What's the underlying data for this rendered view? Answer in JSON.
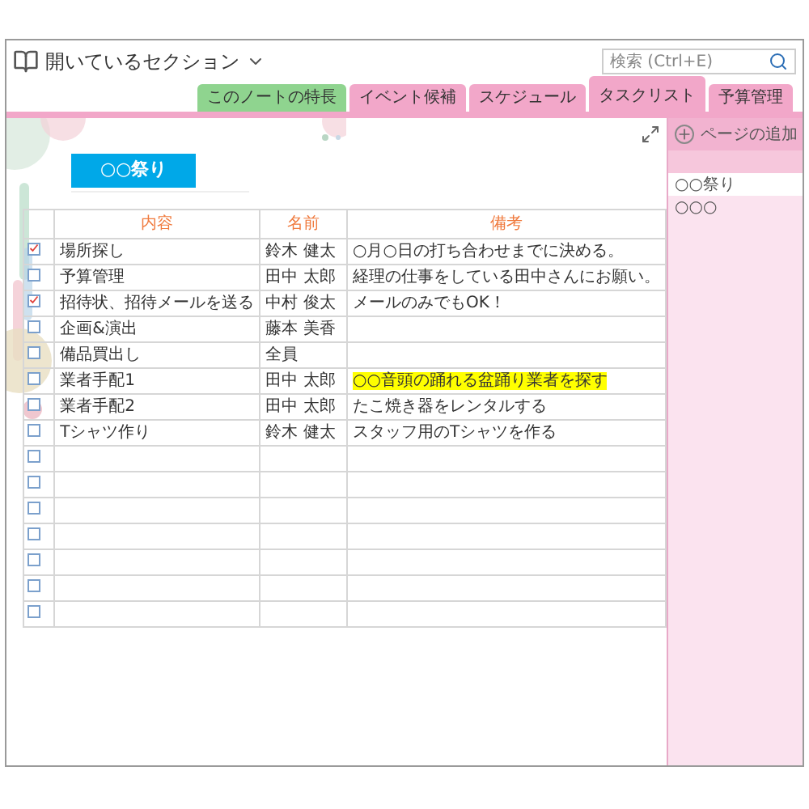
{
  "window": {
    "title": "開いているセクション"
  },
  "search": {
    "placeholder": "検索 (Ctrl+E)"
  },
  "tabs": [
    {
      "label": "このノートの特長",
      "selected": false,
      "color": "#8fd48f"
    },
    {
      "label": "イベント候補",
      "selected": false,
      "color": "#f2a7c9"
    },
    {
      "label": "スケジュール",
      "selected": false,
      "color": "#f2a7c9"
    },
    {
      "label": "タスクリスト",
      "selected": true,
      "color": "#f2a7c9"
    },
    {
      "label": "予算管理",
      "selected": false,
      "color": "#f2a7c9"
    }
  ],
  "page_title": "○○祭り",
  "table": {
    "columns": [
      "内容",
      "名前",
      "備考"
    ],
    "rows": [
      {
        "checked": true,
        "cells": [
          "場所探し",
          "鈴木 健太",
          "○月○日の打ち合わせまでに決める。"
        ],
        "highlighted": false
      },
      {
        "checked": false,
        "cells": [
          "予算管理",
          "田中 太郎",
          "経理の仕事をしている田中さんにお願い。"
        ],
        "highlighted": false
      },
      {
        "checked": true,
        "cells": [
          "招待状、招待メールを送る",
          "中村 俊太",
          "メールのみでもOK！"
        ],
        "highlighted": false
      },
      {
        "checked": false,
        "cells": [
          "企画&演出",
          "藤本 美香",
          ""
        ],
        "highlighted": false
      },
      {
        "checked": false,
        "cells": [
          "備品買出し",
          "全員",
          ""
        ],
        "highlighted": false
      },
      {
        "checked": false,
        "cells": [
          "業者手配1",
          "田中 太郎",
          "○○音頭の踊れる盆踊り業者を探す"
        ],
        "highlighted": true
      },
      {
        "checked": false,
        "cells": [
          "業者手配2",
          "田中 太郎",
          "たこ焼き器をレンタルする"
        ],
        "highlighted": false
      },
      {
        "checked": false,
        "cells": [
          "Tシャツ作り",
          "鈴木 健太",
          "スタッフ用のTシャツを作る"
        ],
        "highlighted": false
      },
      {
        "checked": false,
        "cells": [
          "",
          "",
          ""
        ],
        "highlighted": false
      },
      {
        "checked": false,
        "cells": [
          "",
          "",
          ""
        ],
        "highlighted": false
      },
      {
        "checked": false,
        "cells": [
          "",
          "",
          ""
        ],
        "highlighted": false
      },
      {
        "checked": false,
        "cells": [
          "",
          "",
          ""
        ],
        "highlighted": false
      },
      {
        "checked": false,
        "cells": [
          "",
          "",
          ""
        ],
        "highlighted": false
      },
      {
        "checked": false,
        "cells": [
          "",
          "",
          ""
        ],
        "highlighted": false
      },
      {
        "checked": false,
        "cells": [
          "",
          "",
          ""
        ],
        "highlighted": false
      }
    ]
  },
  "sidebar": {
    "add_page": "ページの追加",
    "pages": [
      {
        "label": "○○祭り",
        "selected": true
      },
      {
        "label": "○○○",
        "selected": false
      }
    ]
  }
}
